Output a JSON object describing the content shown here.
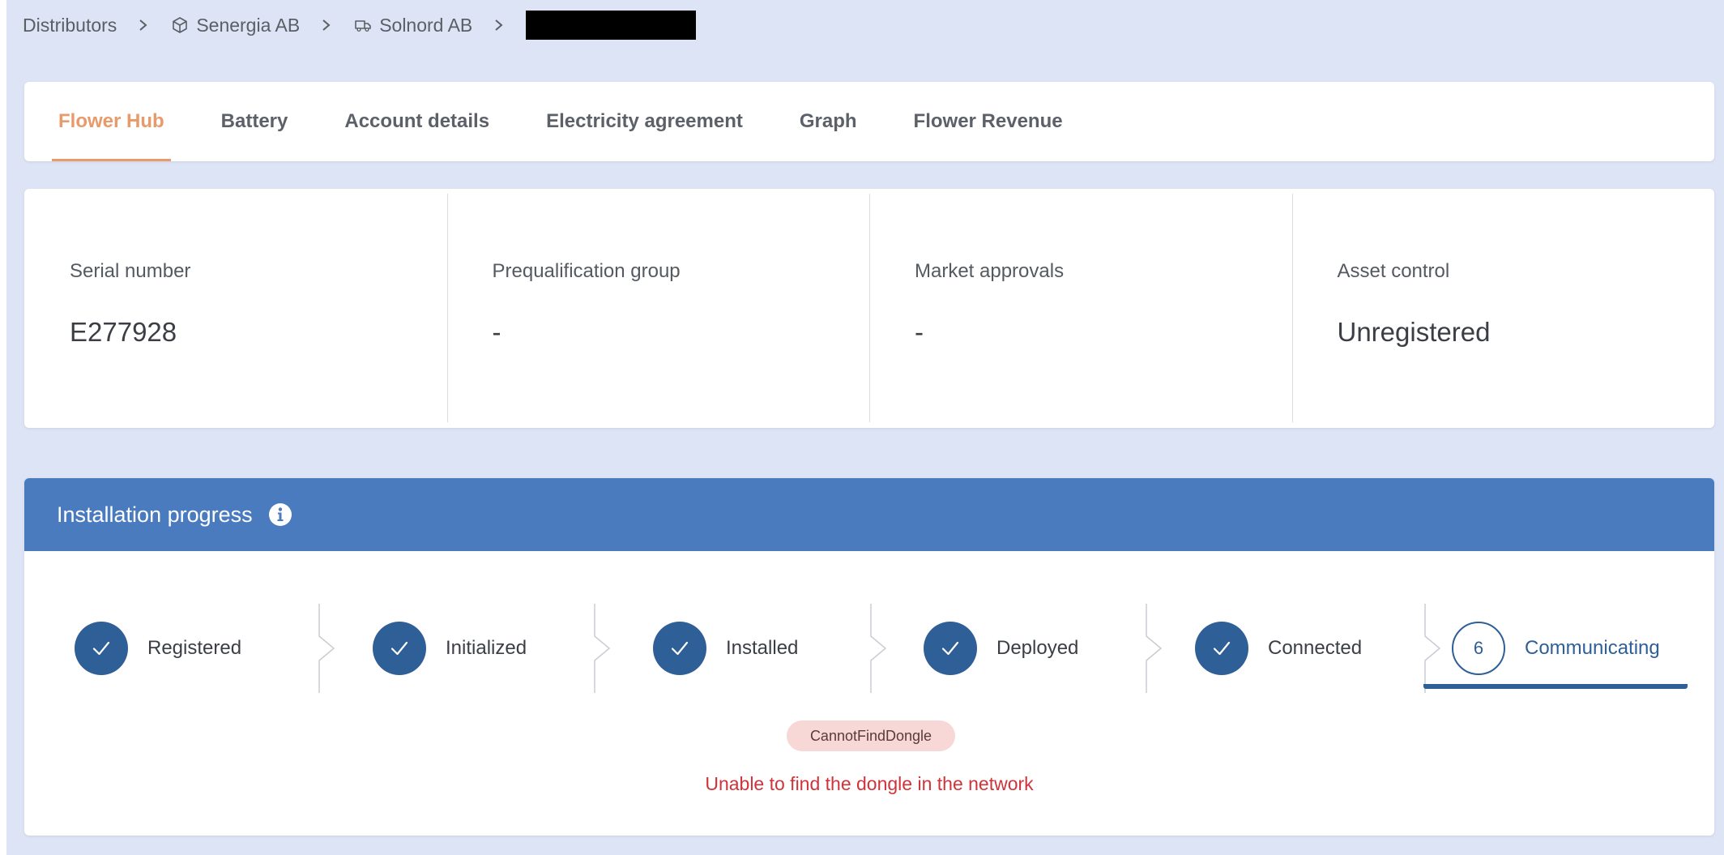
{
  "breadcrumb": {
    "items": [
      {
        "label": "Distributors",
        "icon": null
      },
      {
        "label": "Senergia AB",
        "icon": "cube-icon"
      },
      {
        "label": "Solnord AB",
        "icon": "truck-icon"
      }
    ]
  },
  "tabs": [
    {
      "label": "Flower Hub",
      "active": true
    },
    {
      "label": "Battery",
      "active": false
    },
    {
      "label": "Account details",
      "active": false
    },
    {
      "label": "Electricity agreement",
      "active": false
    },
    {
      "label": "Graph",
      "active": false
    },
    {
      "label": "Flower Revenue",
      "active": false
    }
  ],
  "info": {
    "serial_number": {
      "label": "Serial number",
      "value": "E277928"
    },
    "prequalification_group": {
      "label": "Prequalification group",
      "value": "-"
    },
    "market_approvals": {
      "label": "Market approvals",
      "value": "-"
    },
    "asset_control": {
      "label": "Asset control",
      "value": "Unregistered"
    }
  },
  "progress": {
    "title": "Installation progress",
    "steps": [
      {
        "label": "Registered",
        "done": true
      },
      {
        "label": "Initialized",
        "done": true
      },
      {
        "label": "Installed",
        "done": true
      },
      {
        "label": "Deployed",
        "done": true
      },
      {
        "label": "Connected",
        "done": true
      },
      {
        "label": "Communicating",
        "done": false,
        "number": "6"
      }
    ],
    "error_code": "CannotFindDongle",
    "error_message": "Unable to find the dongle in the network"
  },
  "colors": {
    "accent": "#e99a6a",
    "primary": "#2f5f97",
    "header": "#4a7bbf",
    "error": "#d0333a",
    "background": "#dce4f5"
  }
}
